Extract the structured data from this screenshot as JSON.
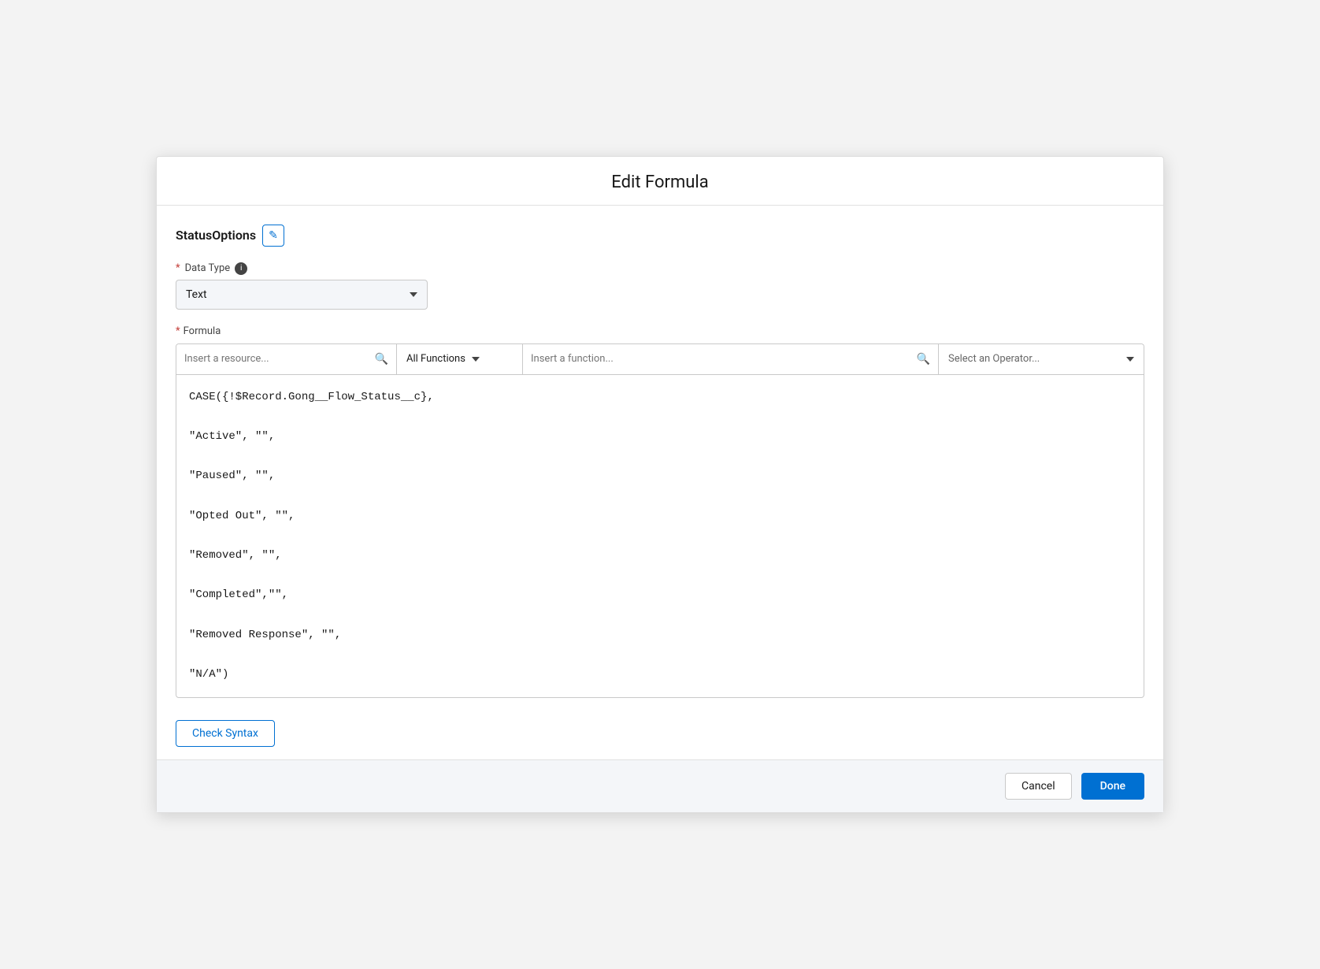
{
  "modal": {
    "title": "Edit Formula"
  },
  "field_name": {
    "name": "StatusOptions",
    "edit_icon_label": "✎"
  },
  "data_type": {
    "label": "Data Type",
    "required": true,
    "selected_value": "Text",
    "info_icon_label": "i"
  },
  "formula": {
    "label": "Formula",
    "required": true,
    "toolbar": {
      "resource_placeholder": "Insert a resource...",
      "functions_label": "All Functions",
      "function_placeholder": "Insert a function...",
      "operator_placeholder": "Select an Operator..."
    },
    "content": "CASE({!$Record.Gong__Flow_Status__c},\n\n\"Active\", \"\",\n\n\"Paused\", \"\",\n\n\"Opted Out\", \"\",\n\n\"Removed\", \"\",\n\n\"Completed\",\"\",\n\n\"Removed Response\", \"\",\n\n\"N/A\")"
  },
  "buttons": {
    "check_syntax": "Check Syntax",
    "cancel": "Cancel",
    "done": "Done"
  }
}
